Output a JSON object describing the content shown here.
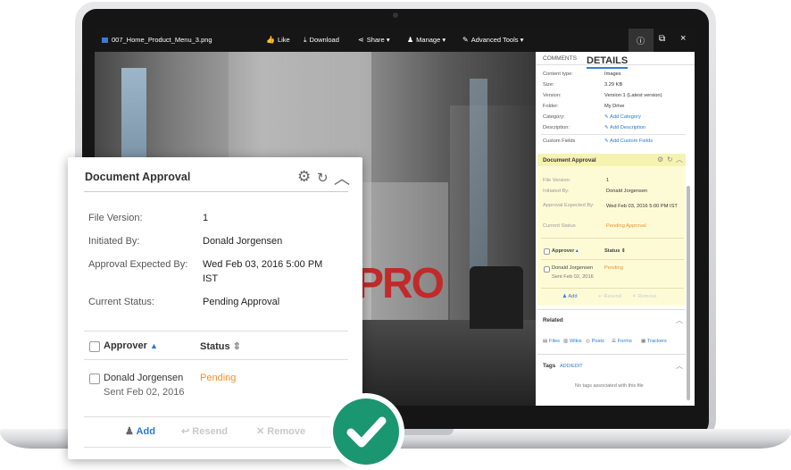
{
  "toolbar": {
    "filename": "007_Home_Product_Menu_3.png",
    "like": "Like",
    "download": "Download",
    "share": "Share",
    "manage": "Manage",
    "advanced_tools": "Advanced Tools"
  },
  "photo": {
    "wall_text": "PRO"
  },
  "panel": {
    "tabs": [
      "COMMENTS",
      "DETAILS"
    ],
    "details": [
      {
        "label": "Content type:",
        "value": "Images"
      },
      {
        "label": "Size:",
        "value": "3.29 KB"
      },
      {
        "label": "Version:",
        "value": "Version 1 (Latest version)"
      },
      {
        "label": "Folder:",
        "value": "My Drive"
      },
      {
        "label": "Category:",
        "value": "Add Category"
      },
      {
        "label": "Description:",
        "value": "Add Description"
      },
      {
        "label": "Custom Fields",
        "value": "Add Custom Fields"
      }
    ],
    "approval": {
      "title": "Document Approval",
      "rows": [
        {
          "label": "File Version:",
          "value": "1"
        },
        {
          "label": "Initiated By:",
          "value": "Donald Jorgensen"
        },
        {
          "label": "Approval Expected By:",
          "value": "Wed Feb 03, 2016 5:00 PM IST"
        },
        {
          "label": "Current Status",
          "value": "Pending Approval"
        }
      ],
      "col_approver": "Approver",
      "col_status": "Status",
      "approver_name": "Donald Jorgensen",
      "approver_sent": "Sent Feb 02, 2016",
      "approver_status": "Pending",
      "add": "Add",
      "resend": "Resend",
      "remove": "Remove"
    },
    "related": {
      "title": "Related",
      "links": [
        "Files",
        "Wikis",
        "Posts",
        "Forms",
        "Trackers"
      ]
    },
    "tags": {
      "title": "Tags",
      "edit": "ADD/EDIT",
      "empty": "No tags associated with this file"
    }
  },
  "card": {
    "title": "Document Approval",
    "file_version_label": "File Version:",
    "file_version": "1",
    "initiated_label": "Initiated By:",
    "initiated": "Donald Jorgensen",
    "expected_label": "Approval Expected By:",
    "expected_line1": "Wed Feb 03, 2016 5:00 PM",
    "expected_line2": "IST",
    "status_label": "Current Status:",
    "status": "Pending Approval",
    "col_approver": "Approver",
    "col_status": "Status",
    "approver_name": "Donald Jorgensen",
    "approver_sent": "Sent Feb 02, 2016",
    "approver_status": "Pending",
    "add": "Add",
    "resend": "Resend",
    "remove": "Remove"
  },
  "colors": {
    "accent": "#2a7ad2",
    "pending": "#f0922b",
    "check": "#1a9670",
    "highlight": "#fdfbd6"
  }
}
